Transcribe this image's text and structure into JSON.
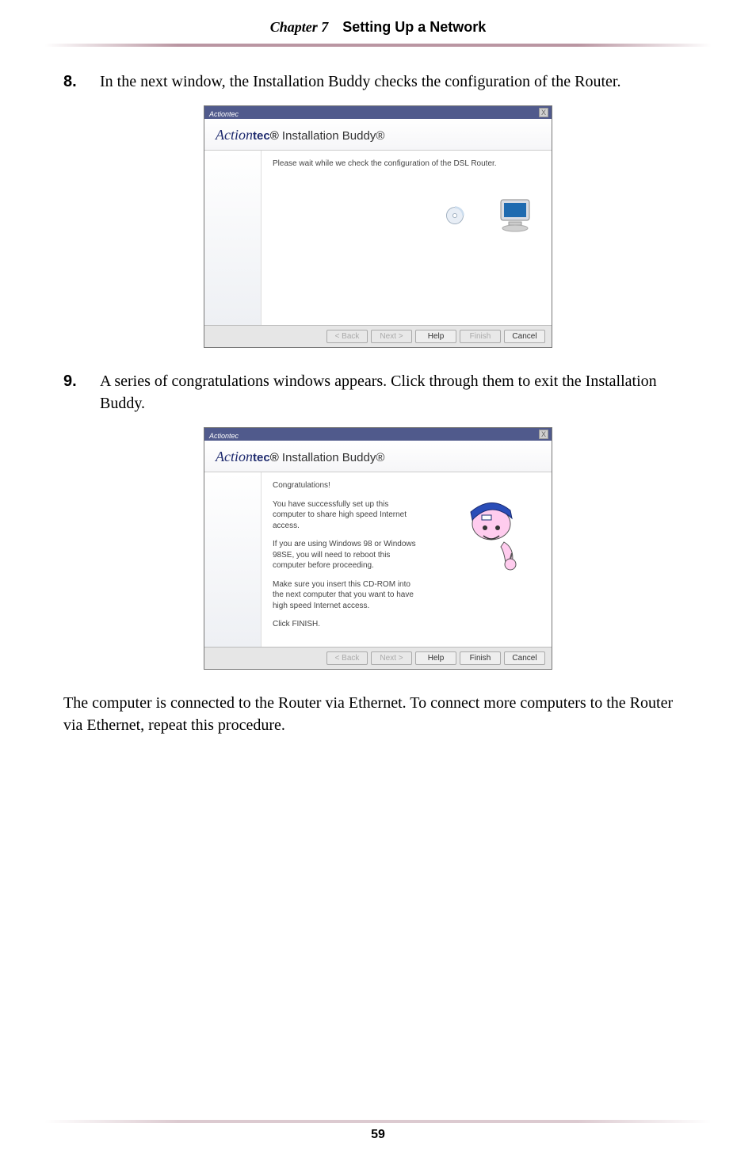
{
  "chapter": {
    "prefix": "Chapter 7",
    "title": "Setting Up a Network"
  },
  "page_number": "59",
  "steps": {
    "s8": {
      "num": "8.",
      "text": "In the next window, the Installation Buddy checks the configuration of the Router."
    },
    "s9": {
      "num": "9.",
      "text": "A series of congratulations windows appears. Click through them to exit the Installation Buddy."
    }
  },
  "closing": "The computer is connected to the Router via Ethernet. To connect more computers to the Router via Ethernet, repeat this procedure.",
  "dialog_common": {
    "titlebar": "Actiontec",
    "brand_script": "Action",
    "brand_bold": "tec",
    "brand_reg": "®",
    "brand_rest": " Installation Buddy®",
    "close_x": "X"
  },
  "dialog1": {
    "body": "Please wait while we check the configuration of the DSL Router.",
    "buttons": {
      "back": "< Back",
      "next": "Next >",
      "help": "Help",
      "finish": "Finish",
      "cancel": "Cancel"
    },
    "states": {
      "back": "disabled",
      "next": "disabled",
      "help": "enabled",
      "finish": "disabled",
      "cancel": "enabled"
    }
  },
  "dialog2": {
    "lines": [
      "Congratulations!",
      "You have successfully set up this computer to share high speed Internet access.",
      "If you are using Windows 98 or Windows 98SE, you will need to reboot this computer before proceeding.",
      "Make sure you insert this CD-ROM into the next computer that you want to have high speed Internet access.",
      "Click FINISH."
    ],
    "buttons": {
      "back": "< Back",
      "next": "Next >",
      "help": "Help",
      "finish": "Finish",
      "cancel": "Cancel"
    },
    "states": {
      "back": "disabled",
      "next": "disabled",
      "help": "enabled",
      "finish": "enabled",
      "cancel": "enabled"
    }
  }
}
